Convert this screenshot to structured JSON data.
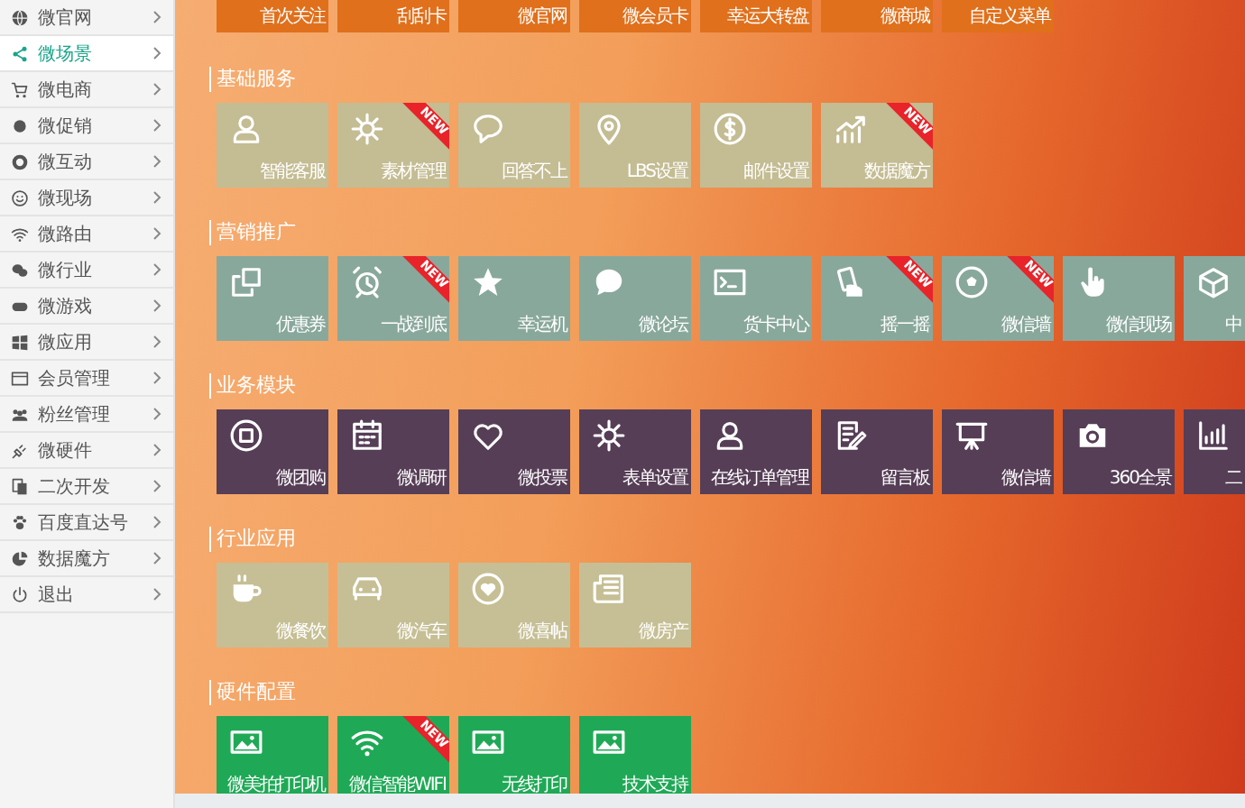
{
  "sidebar": {
    "items": [
      {
        "label": "微官网",
        "selected": false
      },
      {
        "label": "微场景",
        "selected": true
      },
      {
        "label": "微电商",
        "selected": false
      },
      {
        "label": "微促销",
        "selected": false
      },
      {
        "label": "微互动",
        "selected": false
      },
      {
        "label": "微现场",
        "selected": false
      },
      {
        "label": "微路由",
        "selected": false
      },
      {
        "label": "微行业",
        "selected": false
      },
      {
        "label": "微游戏",
        "selected": false
      },
      {
        "label": "微应用",
        "selected": false
      },
      {
        "label": "会员管理",
        "selected": false
      },
      {
        "label": "粉丝管理",
        "selected": false
      },
      {
        "label": "微硬件",
        "selected": false
      },
      {
        "label": "二次开发",
        "selected": false
      },
      {
        "label": "百度直达号",
        "selected": false
      },
      {
        "label": "数据魔方",
        "selected": false
      },
      {
        "label": "退出",
        "selected": false
      }
    ]
  },
  "top_row": {
    "color": "#e0701c",
    "tiles": [
      {
        "label": "首次关注"
      },
      {
        "label": "刮刮卡"
      },
      {
        "label": "微官网"
      },
      {
        "label": "微会员卡"
      },
      {
        "label": "幸运大转盘"
      },
      {
        "label": "微商城"
      },
      {
        "label": "自定义菜单"
      }
    ]
  },
  "sections": [
    {
      "title": "基础服务",
      "color": "#c4bc93",
      "tiles": [
        {
          "label": "智能客服"
        },
        {
          "label": "素材管理",
          "badge": "NEW"
        },
        {
          "label": "回答不上"
        },
        {
          "label": "LBS设置"
        },
        {
          "label": "邮件设置"
        },
        {
          "label": "数据魔方",
          "badge": "NEW"
        }
      ]
    },
    {
      "title": "营销推广",
      "color": "#89a89c",
      "tiles": [
        {
          "label": "优惠券"
        },
        {
          "label": "一战到底",
          "badge": "NEW"
        },
        {
          "label": "幸运机"
        },
        {
          "label": "微论坛"
        },
        {
          "label": "货卡中心"
        },
        {
          "label": "摇一摇",
          "badge": "NEW"
        },
        {
          "label": "微信墙",
          "badge": "NEW"
        },
        {
          "label": "微信现场"
        },
        {
          "label": "中"
        }
      ]
    },
    {
      "title": "业务模块",
      "color": "#563e56",
      "tiles": [
        {
          "label": "微团购"
        },
        {
          "label": "微调研"
        },
        {
          "label": "微投票"
        },
        {
          "label": "表单设置"
        },
        {
          "label": "在线订单管理"
        },
        {
          "label": "留言板"
        },
        {
          "label": "微信墙"
        },
        {
          "label": "360全景"
        },
        {
          "label": "二"
        }
      ]
    },
    {
      "title": "行业应用",
      "color": "#c6bf95",
      "tiles": [
        {
          "label": "微餐饮"
        },
        {
          "label": "微汽车"
        },
        {
          "label": "微喜帖"
        },
        {
          "label": "微房产"
        }
      ]
    },
    {
      "title": "硬件配置",
      "color": "#1fa956",
      "tiles": [
        {
          "label": "微美拍打印机"
        },
        {
          "label": "微信智能WIFI",
          "badge": "NEW"
        },
        {
          "label": "无线打印"
        },
        {
          "label": "技术支持"
        }
      ]
    }
  ]
}
